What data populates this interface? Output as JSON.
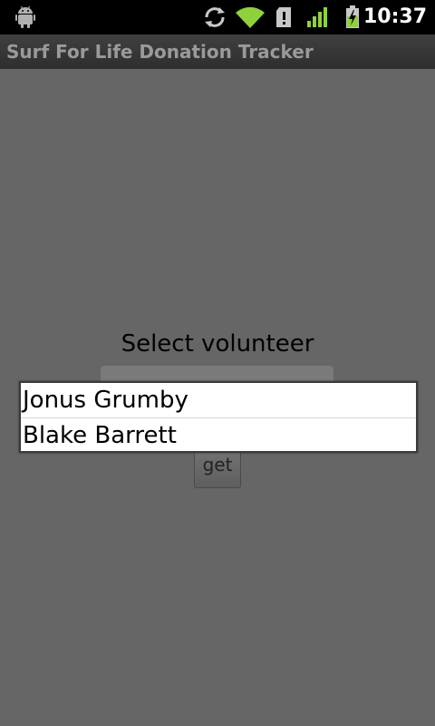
{
  "status_bar": {
    "time": "10:37",
    "icons": [
      "android-icon",
      "sync-icon",
      "wifi-icon",
      "sd-card-warning-icon",
      "signal-icon",
      "battery-charging-icon"
    ]
  },
  "title_bar": {
    "title": "Surf For Life Donation Tracker"
  },
  "content": {
    "select_label": "Select volunteer",
    "button_label": "get"
  },
  "dropdown": {
    "items": [
      {
        "label": "Jonus Grumby"
      },
      {
        "label": "Blake Barrett"
      }
    ]
  },
  "colors": {
    "background": "#666666",
    "status_bar": "#000000",
    "signal_green": "#8fd13b"
  }
}
